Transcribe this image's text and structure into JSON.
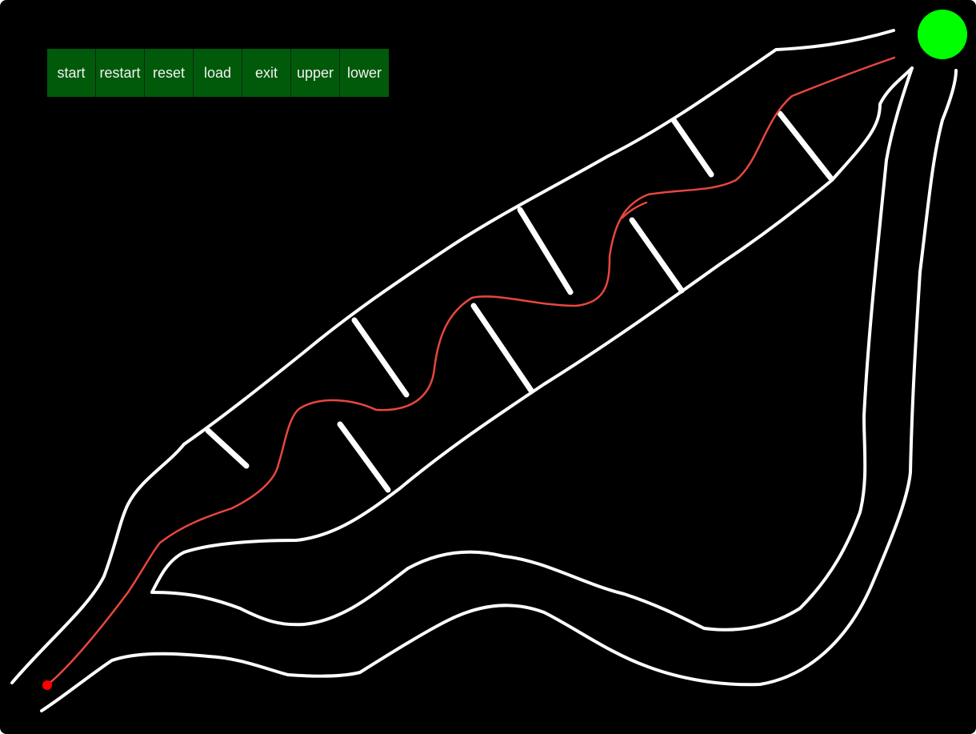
{
  "toolbar": {
    "buttons": [
      {
        "label": "start"
      },
      {
        "label": "restart"
      },
      {
        "label": "reset"
      },
      {
        "label": "load"
      },
      {
        "label": "exit"
      },
      {
        "label": "upper"
      },
      {
        "label": "lower"
      }
    ],
    "button_color": "#005a0a",
    "text_color": "#f2f2f2"
  },
  "game": {
    "background": "#000000",
    "wall_color": "#ffffff",
    "path_color": "#e8473e",
    "start_marker_color": "#ff0000",
    "goal_marker_color": "#00ff00"
  }
}
